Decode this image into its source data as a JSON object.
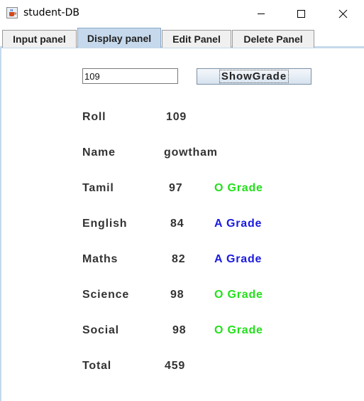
{
  "window": {
    "title": "student-DB",
    "icon": "java-cup-icon"
  },
  "tabs": [
    {
      "label": "Input panel",
      "active": false
    },
    {
      "label": "Display panel",
      "active": true
    },
    {
      "label": "Edit Panel",
      "active": false
    },
    {
      "label": "Delete Panel",
      "active": false
    }
  ],
  "search": {
    "value": "109",
    "button_label": "ShowGrade"
  },
  "record": {
    "roll_label": "Roll",
    "roll": "109",
    "name_label": "Name",
    "name": "gowtham",
    "subjects": [
      {
        "label": "Tamil",
        "mark": "97",
        "grade": "O Grade"
      },
      {
        "label": "English",
        "mark": "84",
        "grade": "A Grade"
      },
      {
        "label": "Maths",
        "mark": "82",
        "grade": "A Grade"
      },
      {
        "label": "Science",
        "mark": "98",
        "grade": "O Grade"
      },
      {
        "label": "Social",
        "mark": "98",
        "grade": "O Grade"
      }
    ],
    "total_label": "Total",
    "total": "459"
  },
  "colors": {
    "o_grade": "#22e01a",
    "a_grade": "#1a1ae0",
    "tab_active": "#c6d9ec"
  }
}
